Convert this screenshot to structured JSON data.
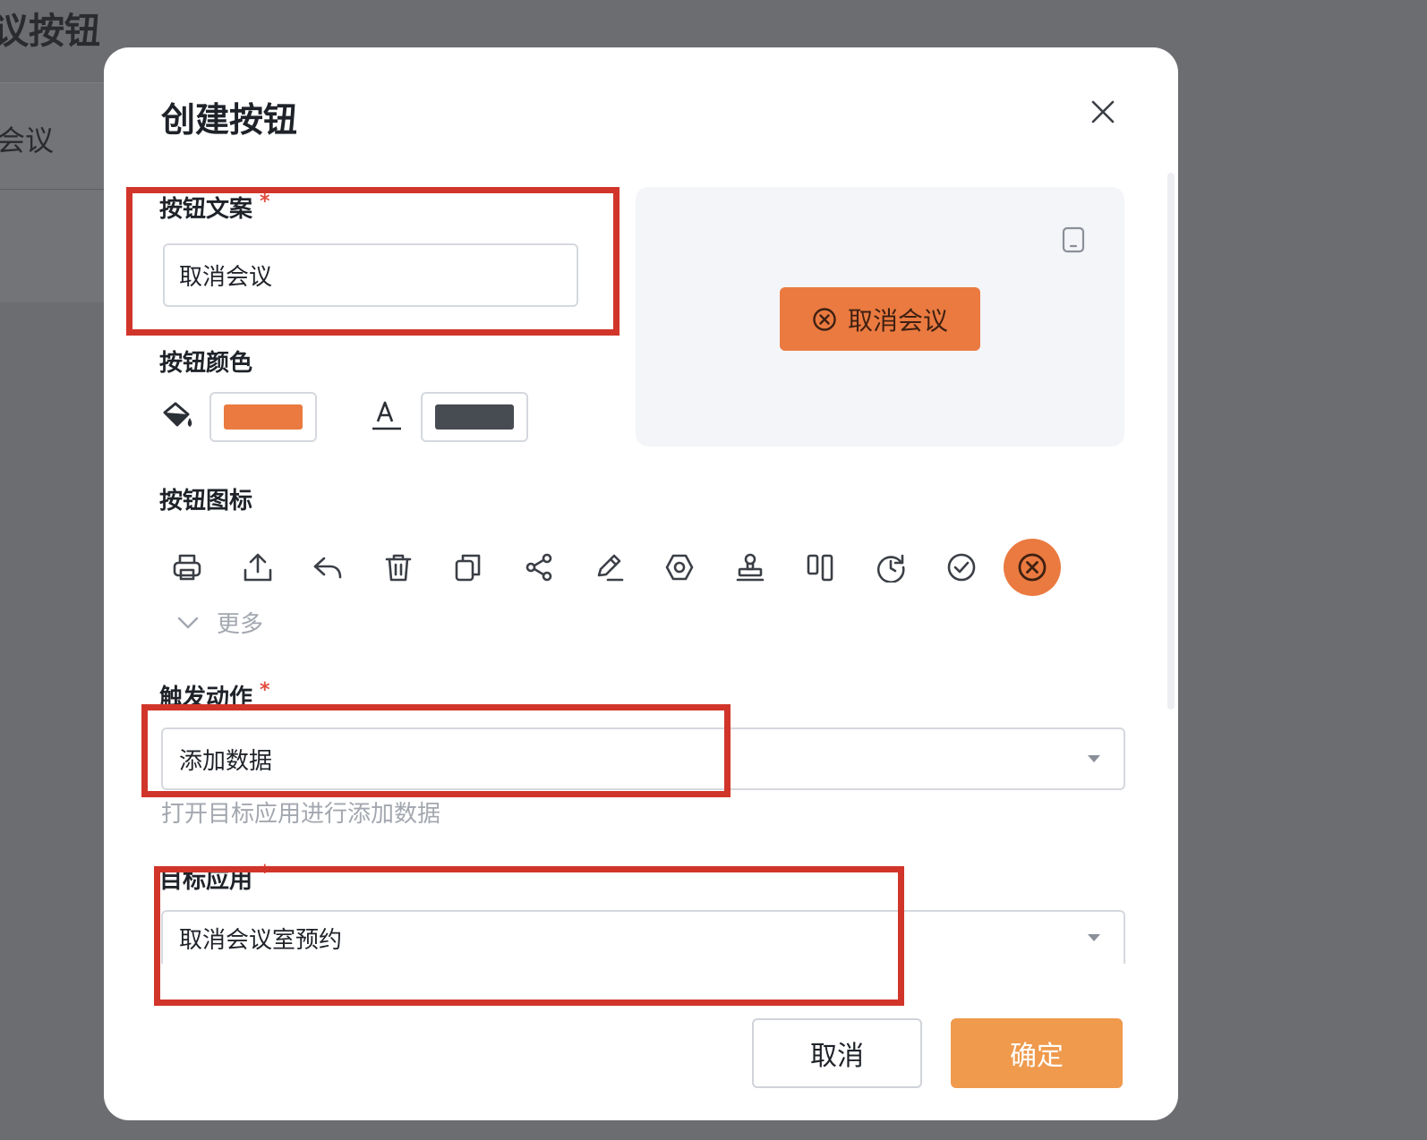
{
  "background": {
    "title": "议按钮",
    "item": "会议"
  },
  "modal": {
    "title": "创建按钮",
    "close_icon": "close-icon"
  },
  "button_text": {
    "label": "按钮文案",
    "required_mark": "*",
    "value": "取消会议"
  },
  "button_color": {
    "label": "按钮颜色",
    "fill_icon": "paint-bucket-icon",
    "fill_color": "#ea7a40",
    "text_icon": "text-color-icon",
    "text_color": "#474b52"
  },
  "preview": {
    "device_icon": "mobile-device-icon",
    "button_label": "取消会议",
    "button_icon": "circle-x-icon",
    "button_color": "#ea7a40"
  },
  "button_icon": {
    "label": "按钮图标",
    "icons": [
      "print-icon",
      "upload-icon",
      "reply-icon",
      "trash-icon",
      "copy-icon",
      "share-icon",
      "edit-icon",
      "settings-icon",
      "stamp-icon",
      "columns-icon",
      "history-icon",
      "check-circle-icon",
      "circle-x-icon"
    ],
    "selected": "circle-x-icon",
    "more_label": "更多"
  },
  "trigger_action": {
    "label": "触发动作",
    "required_mark": "*",
    "value": "添加数据",
    "hint": "打开目标应用进行添加数据"
  },
  "target_app": {
    "label": "目标应用",
    "required_mark": "*",
    "value": "取消会议室预约"
  },
  "footer": {
    "cancel_label": "取消",
    "confirm_label": "确定"
  }
}
